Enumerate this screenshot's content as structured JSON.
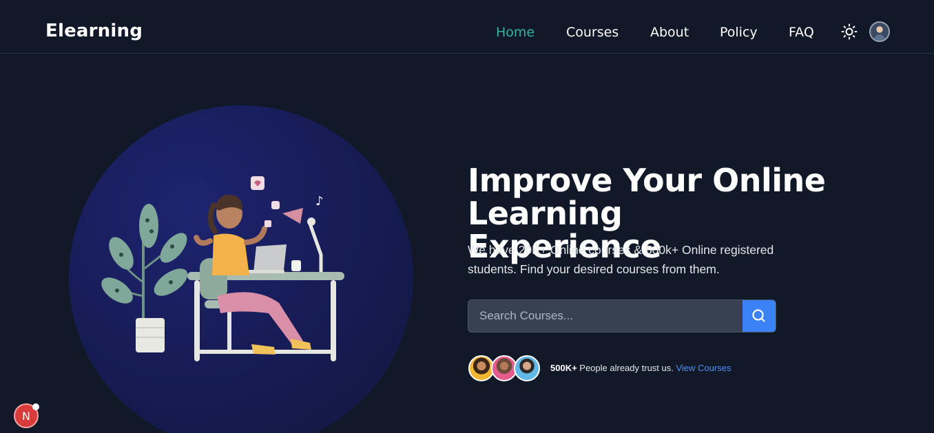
{
  "header": {
    "brand": "Elearning",
    "nav": [
      {
        "label": "Home",
        "active": true
      },
      {
        "label": "Courses",
        "active": false
      },
      {
        "label": "About",
        "active": false
      },
      {
        "label": "Policy",
        "active": false
      },
      {
        "label": "FAQ",
        "active": false
      }
    ],
    "theme_icon": "sun-icon",
    "avatar_icon": "user-avatar"
  },
  "hero": {
    "title_line1": "Improve Your Online",
    "title_line2": "Learning Experience",
    "subtitle": "We have 20K+ Online courses & 500k+ Online registered students. Find your desired courses from them.",
    "search": {
      "placeholder": "Search Courses...",
      "value": "",
      "button_icon": "search-icon"
    },
    "trust": {
      "count": "500K+",
      "text": " People already trust us. ",
      "link": "View Courses"
    }
  },
  "dev_indicator": {
    "label": "N"
  },
  "colors": {
    "background": "#111827",
    "accent_active_nav": "#34b4a4",
    "search_button": "#3b82f6",
    "link": "#4f8ff7",
    "hero_circle": "#1a1f5e"
  }
}
